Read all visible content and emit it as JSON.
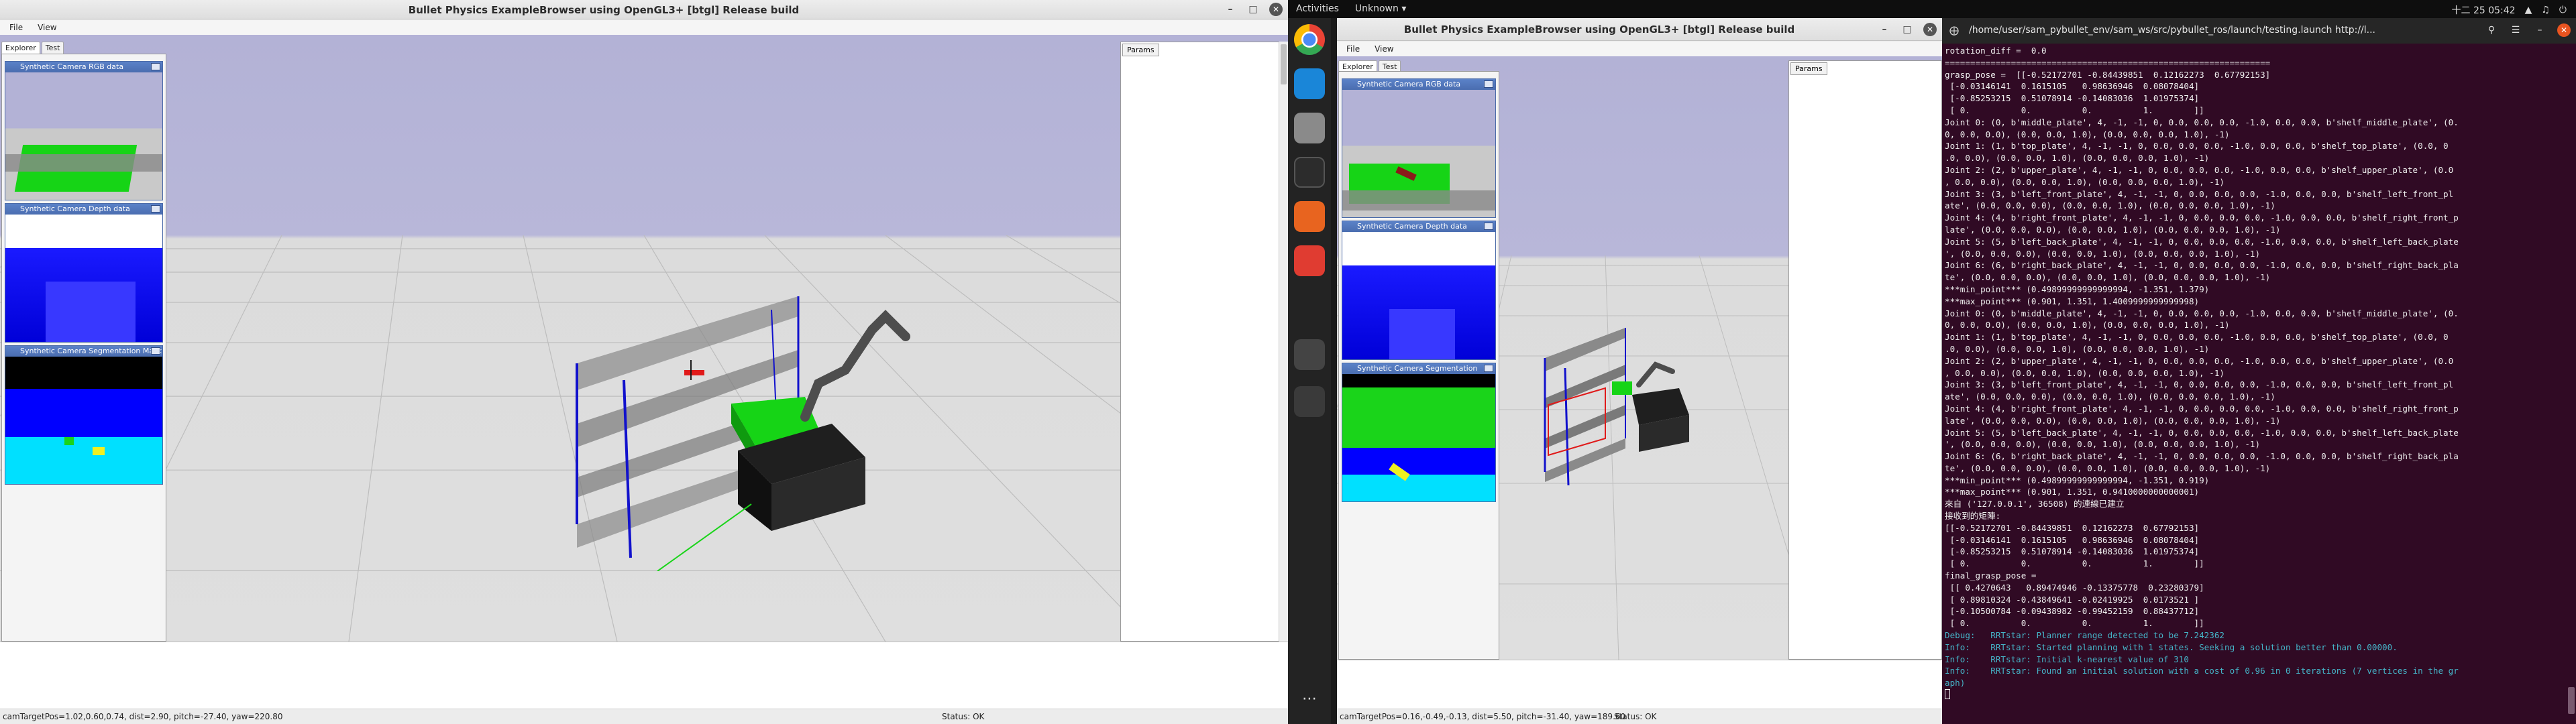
{
  "left_window": {
    "title": "Bullet Physics ExampleBrowser using OpenGL3+ [btgl] Release build",
    "menu": [
      "File",
      "View"
    ],
    "tabs": [
      "Explorer",
      "Test"
    ],
    "params_tab": "Params",
    "cam_rgb": "Synthetic Camera RGB data",
    "cam_depth": "Synthetic Camera Depth data",
    "cam_seg": "Synthetic Camera Segmentation Mask",
    "status_left": "camTargetPos=1.02,0.60,0.74, dist=2.90, pitch=-27.40, yaw=220.80",
    "status_right": "Status: OK"
  },
  "right_window": {
    "title": "Bullet Physics ExampleBrowser using OpenGL3+ [btgl] Release build",
    "menu": [
      "File",
      "View"
    ],
    "tabs": [
      "Explorer",
      "Test"
    ],
    "params_tab": "Params",
    "cam_rgb": "Synthetic Camera RGB data",
    "cam_depth": "Synthetic Camera Depth data",
    "cam_seg": "Synthetic Camera Segmentation Mask",
    "status_left": "camTargetPos=0.16,-0.49,-0.13, dist=5.50, pitch=-31.40, yaw=189.60",
    "status_right": "Status: OK"
  },
  "topbar": {
    "activities": "Activities",
    "workspace": "Unknown ▾",
    "clock": "十二 25 05:42"
  },
  "terminal": {
    "title": "/home/user/sam_pybullet_env/sam_ws/src/pybullet_ros/launch/testing.launch http://l...",
    "lines": [
      "rotation_diff =  0.0",
      "================================================================",
      "grasp_pose =  [[-0.52172701 -0.84439851  0.12162273  0.67792153]",
      " [-0.03146141  0.1615105   0.98636946  0.08078404]",
      " [-0.85253215  0.51078914 -0.14083036  1.01975374]",
      " [ 0.          0.          0.          1.        ]]",
      "Joint 0: (0, b'middle_plate', 4, -1, -1, 0, 0.0, 0.0, 0.0, -1.0, 0.0, 0.0, b'shelf_middle_plate', (0.",
      "0, 0.0, 0.0), (0.0, 0.0, 1.0), (0.0, 0.0, 0.0, 1.0), -1)",
      "Joint 1: (1, b'top_plate', 4, -1, -1, 0, 0.0, 0.0, 0.0, -1.0, 0.0, 0.0, b'shelf_top_plate', (0.0, 0",
      ".0, 0.0), (0.0, 0.0, 1.0), (0.0, 0.0, 0.0, 1.0), -1)",
      "Joint 2: (2, b'upper_plate', 4, -1, -1, 0, 0.0, 0.0, 0.0, -1.0, 0.0, 0.0, b'shelf_upper_plate', (0.0",
      ", 0.0, 0.0), (0.0, 0.0, 1.0), (0.0, 0.0, 0.0, 1.0), -1)",
      "Joint 3: (3, b'left_front_plate', 4, -1, -1, 0, 0.0, 0.0, 0.0, -1.0, 0.0, 0.0, b'shelf_left_front_pl",
      "ate', (0.0, 0.0, 0.0), (0.0, 0.0, 1.0), (0.0, 0.0, 0.0, 1.0), -1)",
      "Joint 4: (4, b'right_front_plate', 4, -1, -1, 0, 0.0, 0.0, 0.0, -1.0, 0.0, 0.0, b'shelf_right_front_p",
      "late', (0.0, 0.0, 0.0), (0.0, 0.0, 1.0), (0.0, 0.0, 0.0, 1.0), -1)",
      "Joint 5: (5, b'left_back_plate', 4, -1, -1, 0, 0.0, 0.0, 0.0, -1.0, 0.0, 0.0, b'shelf_left_back_plate",
      "', (0.0, 0.0, 0.0), (0.0, 0.0, 1.0), (0.0, 0.0, 0.0, 1.0), -1)",
      "Joint 6: (6, b'right_back_plate', 4, -1, -1, 0, 0.0, 0.0, 0.0, -1.0, 0.0, 0.0, b'shelf_right_back_pla",
      "te', (0.0, 0.0, 0.0), (0.0, 0.0, 1.0), (0.0, 0.0, 0.0, 1.0), -1)",
      "***min_point*** (0.49899999999999994, -1.351, 1.379)",
      "***max_point*** (0.901, 1.351, 1.4009999999999998)",
      "Joint 0: (0, b'middle_plate', 4, -1, -1, 0, 0.0, 0.0, 0.0, -1.0, 0.0, 0.0, b'shelf_middle_plate', (0.",
      "0, 0.0, 0.0), (0.0, 0.0, 1.0), (0.0, 0.0, 0.0, 1.0), -1)",
      "Joint 1: (1, b'top_plate', 4, -1, -1, 0, 0.0, 0.0, 0.0, -1.0, 0.0, 0.0, b'shelf_top_plate', (0.0, 0",
      ".0, 0.0), (0.0, 0.0, 1.0), (0.0, 0.0, 0.0, 1.0), -1)",
      "Joint 2: (2, b'upper_plate', 4, -1, -1, 0, 0.0, 0.0, 0.0, -1.0, 0.0, 0.0, b'shelf_upper_plate', (0.0",
      ", 0.0, 0.0), (0.0, 0.0, 1.0), (0.0, 0.0, 0.0, 1.0), -1)",
      "Joint 3: (3, b'left_front_plate', 4, -1, -1, 0, 0.0, 0.0, 0.0, -1.0, 0.0, 0.0, b'shelf_left_front_pl",
      "ate', (0.0, 0.0, 0.0), (0.0, 0.0, 1.0), (0.0, 0.0, 0.0, 1.0), -1)",
      "Joint 4: (4, b'right_front_plate', 4, -1, -1, 0, 0.0, 0.0, 0.0, -1.0, 0.0, 0.0, b'shelf_right_front_p",
      "late', (0.0, 0.0, 0.0), (0.0, 0.0, 1.0), (0.0, 0.0, 0.0, 1.0), -1)",
      "Joint 5: (5, b'left_back_plate', 4, -1, -1, 0, 0.0, 0.0, 0.0, -1.0, 0.0, 0.0, b'shelf_left_back_plate",
      "', (0.0, 0.0, 0.0), (0.0, 0.0, 1.0), (0.0, 0.0, 0.0, 1.0), -1)",
      "Joint 6: (6, b'right_back_plate', 4, -1, -1, 0, 0.0, 0.0, 0.0, -1.0, 0.0, 0.0, b'shelf_right_back_pla",
      "te', (0.0, 0.0, 0.0), (0.0, 0.0, 1.0), (0.0, 0.0, 0.0, 1.0), -1)",
      "***min_point*** (0.49899999999999994, -1.351, 0.919)",
      "***max_point*** (0.901, 1.351, 0.9410000000000001)",
      "來自 ('127.0.0.1', 36508) 的連線已建立",
      "接收到的矩陣:",
      "[[-0.52172701 -0.84439851  0.12162273  0.67792153]",
      " [-0.03146141  0.1615105   0.98636946  0.08078404]",
      " [-0.85253215  0.51078914 -0.14083036  1.01975374]",
      " [ 0.          0.          0.          1.        ]]",
      "final_grasp_pose =",
      " [[ 0.4270643   0.89474946 -0.13375778  0.23280379]",
      " [ 0.89810324 -0.43849641 -0.02419925  0.0173521 ]",
      " [-0.10500784 -0.09438982 -0.99452159  0.88437712]",
      " [ 0.          0.          0.          1.        ]]"
    ],
    "info_lines": [
      "Debug:   RRTstar: Planner range detected to be 7.242362",
      "Info:    RRTstar: Started planning with 1 states. Seeking a solution better than 0.00000.",
      "Info:    RRTstar: Initial k-nearest value of 310",
      "Info:    RRTstar: Found an initial solution with a cost of 0.96 in 0 iterations (7 vertices in the gr",
      "aph)"
    ]
  }
}
